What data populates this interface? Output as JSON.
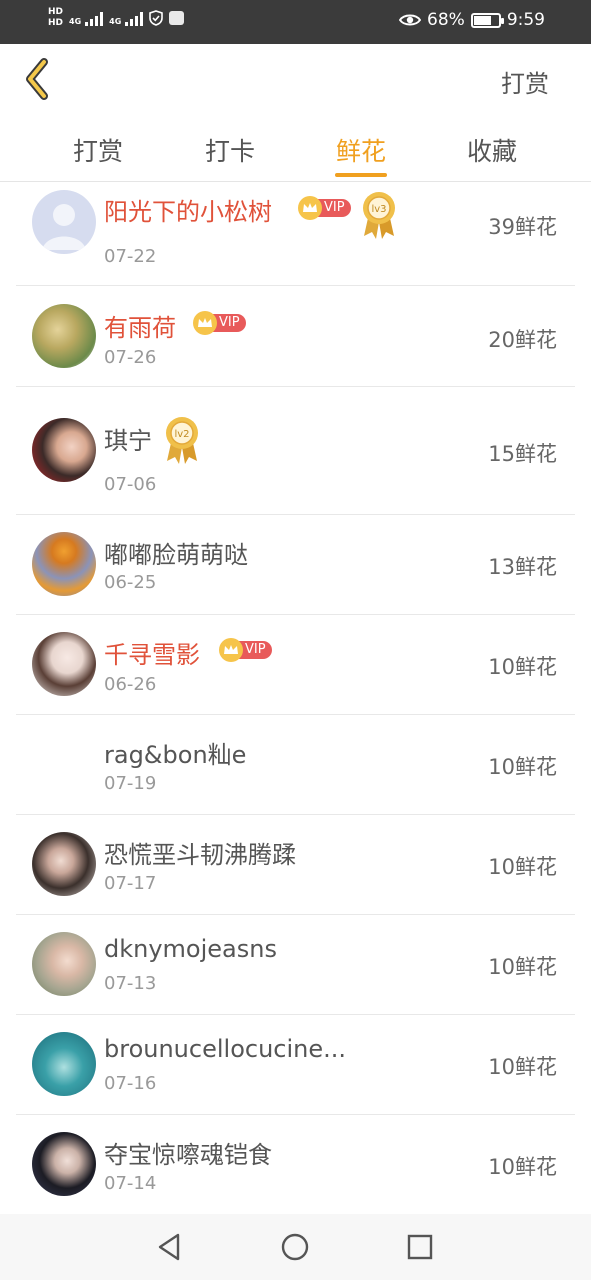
{
  "status_bar": {
    "hd1": "HD",
    "hd2": "HD",
    "net1": "4G",
    "net2": "4G",
    "battery": "68%",
    "battery_level": 0.68,
    "time": "9:59",
    "icons": [
      "eye-icon",
      "shield-icon",
      "battery-icon"
    ]
  },
  "header": {
    "back_icon": "chevron-left-icon",
    "action": "打赏"
  },
  "tabs": [
    {
      "label": "打赏",
      "active": false
    },
    {
      "label": "打卡",
      "active": false
    },
    {
      "label": "鲜花",
      "active": true
    },
    {
      "label": "收藏",
      "active": false
    }
  ],
  "vip_label": "VIP",
  "entries": [
    {
      "name": "阳光下的小松树",
      "date": "07-22",
      "amount": "39鲜花",
      "vip": true,
      "medal": "lv3"
    },
    {
      "name": "有雨荷",
      "date": "07-26",
      "amount": "20鲜花",
      "vip": true,
      "medal": ""
    },
    {
      "name": "琪宁",
      "date": "07-06",
      "amount": "15鲜花",
      "vip": false,
      "medal": "lv2"
    },
    {
      "name": "嘟嘟脸萌萌哒",
      "date": "06-25",
      "amount": "13鲜花",
      "vip": false,
      "medal": ""
    },
    {
      "name": "千寻雪影",
      "date": "06-26",
      "amount": "10鲜花",
      "vip": true,
      "medal": ""
    },
    {
      "name": "rag&bon籼e",
      "date": "07-19",
      "amount": "10鲜花",
      "vip": false,
      "medal": ""
    },
    {
      "name": "恐慌垩斗韧沸腾蹂",
      "date": "07-17",
      "amount": "10鲜花",
      "vip": false,
      "medal": ""
    },
    {
      "name": "dknymojeasns",
      "date": "07-13",
      "amount": "10鲜花",
      "vip": false,
      "medal": ""
    },
    {
      "name": "brounucellocucine...",
      "date": "07-16",
      "amount": "10鲜花",
      "vip": false,
      "medal": ""
    },
    {
      "name": "夺宝惊嚓魂铠食",
      "date": "07-14",
      "amount": "10鲜花",
      "vip": false,
      "medal": ""
    }
  ],
  "colors": {
    "accent": "#f0a020",
    "vip_name": "#e0523a",
    "status_bar": "#3b3b3b"
  },
  "nav": {
    "back": "triangle-back-icon",
    "home": "circle-home-icon",
    "recents": "square-recents-icon"
  }
}
